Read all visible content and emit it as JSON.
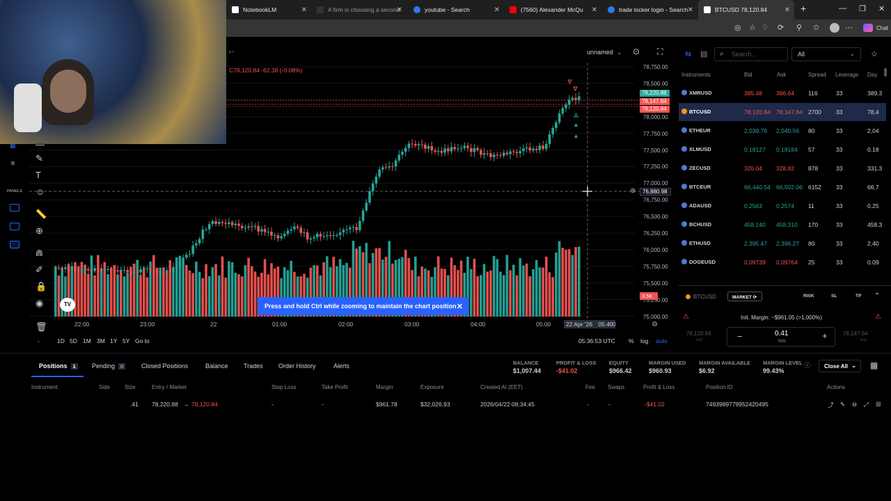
{
  "browser": {
    "tabs": [
      {
        "title": "NotebookLM",
        "active": false
      },
      {
        "title": "A firm is choosing a second",
        "active": false
      },
      {
        "title": "youtube - Search",
        "active": false
      },
      {
        "title": "(7560) Alexander McQu",
        "active": false
      },
      {
        "title": "trade locker login - Search",
        "active": false
      },
      {
        "title": "BTCUSD 78,120.84",
        "active": true
      }
    ],
    "chat_label": "Chat"
  },
  "chart": {
    "name": "unnamed",
    "ohlc_text": "C78,120.84  -62.38 (-0.08%)",
    "price_axis": [
      "78,750.00",
      "78,500.00",
      "78,250.00",
      "78,000.00",
      "77,750.00",
      "77,500.00",
      "77,250.00",
      "77,000.00",
      "76,750.00",
      "76,500.00",
      "76,250.00",
      "76,000.00",
      "75,750.00",
      "75,500.00",
      "75,250.00",
      "75,000.00"
    ],
    "price_flags": [
      {
        "text": "78,220.88",
        "color": "#26a69a"
      },
      {
        "text": "78,147.84",
        "color": "#ef5350"
      },
      {
        "text": "78,120.84",
        "color": "#ef5350"
      }
    ],
    "crosshair_price": "76,880.98",
    "volume_label": "3.5K",
    "time_axis": [
      "22:00",
      "23:00",
      "22",
      "01:00",
      "02:00",
      "03:00",
      "04:00",
      "05:00"
    ],
    "crosshair_time": "22 Apr '26",
    "crosshair_time2": "05:40",
    "time_axis_last": "0",
    "toast": "Press and hold Ctrl while zooming to maintain the chart position",
    "ranges": [
      "1D",
      "5D",
      "1M",
      "3M",
      "1Y",
      "5Y",
      "Go to"
    ],
    "clock": "05:36:53 UTC",
    "scale_opts": [
      "%",
      "log",
      "auto"
    ],
    "colors": {
      "up": "#26a69a",
      "down": "#ef5350",
      "accent": "#2962ff"
    }
  },
  "instruments": {
    "search_placeholder": "Search...",
    "filter": "All",
    "headers": [
      "Instruments",
      "Bid",
      "Ask",
      "Spread",
      "Leverage",
      "Day"
    ],
    "rows": [
      {
        "sym": "XMRUSD",
        "bid": "385.48",
        "ask": "386.64",
        "spread": "116",
        "lev": "33",
        "day": "389.3",
        "color": "#ef5350"
      },
      {
        "sym": "BTCUSD",
        "bid": "78,120.84",
        "ask": "78,147.84",
        "spread": "2700",
        "lev": "33",
        "day": "78,4",
        "color": "#ef5350"
      },
      {
        "sym": "ETHEUR",
        "bid": "2,039.76",
        "ask": "2,040.56",
        "spread": "80",
        "lev": "33",
        "day": "2,04",
        "color": "#26a69a"
      },
      {
        "sym": "XLMUSD",
        "bid": "0.18127",
        "ask": "0.18184",
        "spread": "57",
        "lev": "33",
        "day": "0.18",
        "color": "#26a69a"
      },
      {
        "sym": "ZECUSD",
        "bid": "320.04",
        "ask": "328.82",
        "spread": "878",
        "lev": "33",
        "day": "331.3",
        "color": "#ef5350"
      },
      {
        "sym": "BTCEUR",
        "bid": "66,440.54",
        "ask": "66,502.06",
        "spread": "6152",
        "lev": "33",
        "day": "66,7",
        "color": "#26a69a"
      },
      {
        "sym": "ADAUSD",
        "bid": "0.2563",
        "ask": "0.2574",
        "spread": "11",
        "lev": "33",
        "day": "0.25",
        "color": "#26a69a"
      },
      {
        "sym": "BCHUSD",
        "bid": "458.140",
        "ask": "458.310",
        "spread": "170",
        "lev": "33",
        "day": "458.3",
        "color": "#26a69a"
      },
      {
        "sym": "ETHUSD",
        "bid": "2,395.47",
        "ask": "2,396.27",
        "spread": "80",
        "lev": "33",
        "day": "2,40",
        "color": "#26a69a"
      },
      {
        "sym": "DOGEUSD",
        "bid": "0.09739",
        "ask": "0.09764",
        "spread": "25",
        "lev": "33",
        "day": "0.09",
        "color": "#ef5350"
      }
    ]
  },
  "order": {
    "symbol": "BTCUSD",
    "type": "MARKET",
    "risk": "RISK",
    "sl": "SL",
    "tp": "TP",
    "margin": "Init. Margin: ~$961.05 (>1,000%)",
    "bid": "78,120.84",
    "ask": "78,147.84",
    "lots": "0.41",
    "lots_unit": "lots",
    "bid_sub": "sell",
    "ask_sub": "buy"
  },
  "bottom": {
    "tabs": [
      {
        "label": "Positions",
        "count": "1"
      },
      {
        "label": "Pending",
        "count": "0"
      },
      {
        "label": "Closed Positions"
      },
      {
        "label": "Balance"
      },
      {
        "label": "Trades"
      },
      {
        "label": "Order History"
      },
      {
        "label": "Alerts"
      }
    ],
    "account": [
      {
        "k": "BALANCE",
        "v": "$1,007.44",
        "c": "#d1d4dc"
      },
      {
        "k": "PROFIT & LOSS",
        "v": "-$41.02",
        "c": "#ef5350"
      },
      {
        "k": "EQUITY",
        "v": "$966.42",
        "c": "#d1d4dc"
      },
      {
        "k": "MARGIN USED",
        "v": "$960.93",
        "c": "#d1d4dc"
      },
      {
        "k": "MARGIN AVAILABLE",
        "v": "$6.92",
        "c": "#d1d4dc"
      },
      {
        "k": "MARGIN LEVEL",
        "v": "99.43%",
        "c": "#d1d4dc"
      }
    ],
    "close_all": "Close All",
    "headers": [
      "Instrument",
      "Side",
      "Size",
      "Entry / Market",
      "Stop Loss",
      "Take Profit",
      "Margin",
      "Exposure",
      "Created At (EET)",
      "Fee",
      "Swaps",
      "Profit & Loss",
      "Position ID",
      "Actions"
    ],
    "row": {
      "size": ".41",
      "entry": "78,220.88",
      "market": "78,120.84",
      "sl": "-",
      "tp": "-",
      "margin": "$961.78",
      "exposure": "$32,026.93",
      "created": "2026/04/22 08:34:45",
      "fee": "-",
      "swaps": "-",
      "pnl": "-$41.02",
      "id": "7493989779952420495"
    }
  }
}
